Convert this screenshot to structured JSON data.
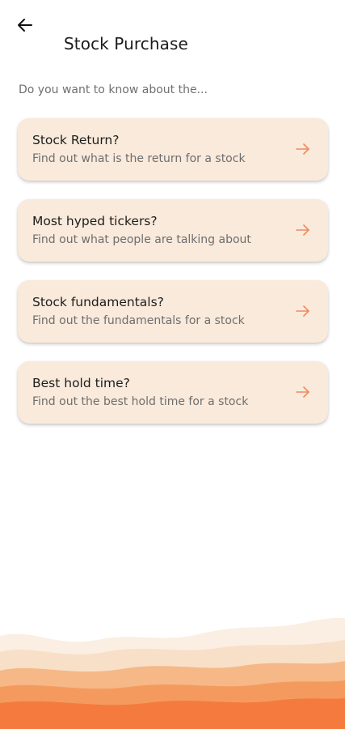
{
  "header": {
    "back_icon": "arrow-left-icon",
    "title": "Stock Purchase"
  },
  "prompt": "Do you want to know about the...",
  "cards": [
    {
      "title": "Stock Return?",
      "description": "Find out what is the return for a stock",
      "icon": "arrow-right-icon"
    },
    {
      "title": "Most hyped tickers?",
      "description": "Find out what people are talking about",
      "icon": "arrow-right-icon"
    },
    {
      "title": "Stock fundamentals?",
      "description": "Find out the fundamentals for a stock",
      "icon": "arrow-right-icon"
    },
    {
      "title": "Best hold time?",
      "description": "Find out the best hold time for a stock",
      "icon": "arrow-right-icon"
    }
  ],
  "colors": {
    "card_background": "#f9eadb",
    "accent": "#ef8a5e",
    "wave_light": "#f9e6d4",
    "wave_mid": "#f6b886",
    "wave_dark": "#f57a3d"
  }
}
